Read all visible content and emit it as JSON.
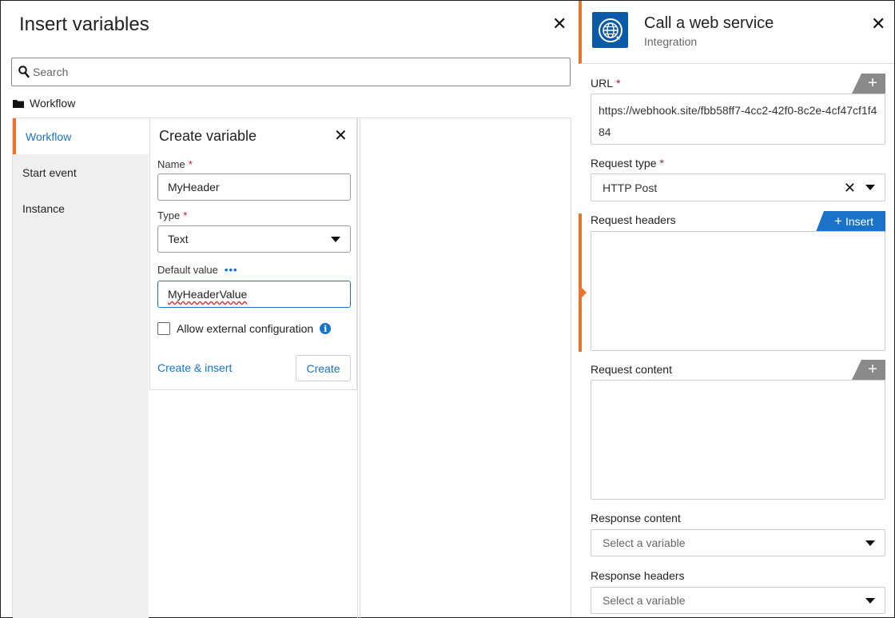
{
  "insert_dialog": {
    "title": "Insert variables",
    "close": "✕",
    "search_placeholder": "Search",
    "breadcrumb": "Workflow",
    "nav_items": [
      "Workflow",
      "Start event",
      "Instance"
    ],
    "create_variable": {
      "title": "Create variable",
      "close": "✕",
      "name_label": "Name",
      "name_value": "MyHeader",
      "type_label": "Type",
      "type_value": "Text",
      "default_label": "Default value",
      "default_more": "•••",
      "default_value": "MyHeaderValue",
      "allow_external": "Allow external configuration",
      "info_glyph": "i",
      "create_insert_label": "Create & insert",
      "create_label": "Create",
      "required_mark": "*"
    }
  },
  "web_service_panel": {
    "title": "Call a web service",
    "subtitle": "Integration",
    "close": "✕",
    "url_label": "URL",
    "url_value": "https://webhook.site/fbb58ff7-4cc2-42f0-8c2e-4cf47cf1f484",
    "request_type_label": "Request type",
    "request_type_value": "HTTP Post",
    "clear_glyph": "✕",
    "request_headers_label": "Request headers",
    "insert_label": "Insert",
    "request_content_label": "Request content",
    "response_content_label": "Response content",
    "response_content_placeholder": "Select a variable",
    "response_headers_label": "Response headers",
    "response_headers_placeholder": "Select a variable",
    "plus_glyph": "+",
    "required_mark": "*"
  },
  "colors": {
    "accent_orange": "#e9742b",
    "link_blue": "#1a73c8",
    "brand_blue": "#0b5aa8",
    "required_red": "#c8102e"
  },
  "icons": [
    "close-icon",
    "search-icon",
    "folder-icon",
    "info-icon",
    "caret-down-icon",
    "globe-icon",
    "plus-icon"
  ]
}
